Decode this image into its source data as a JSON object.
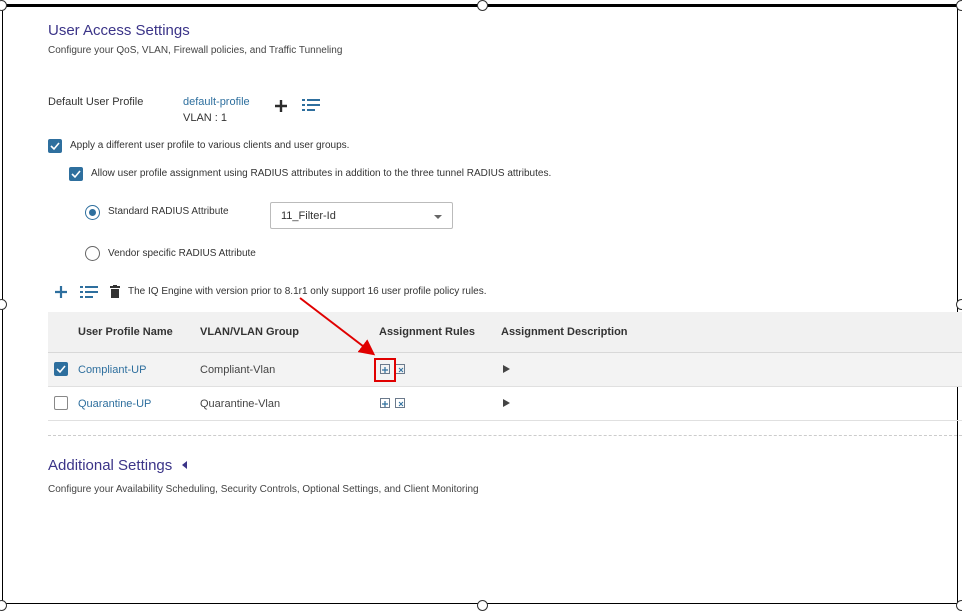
{
  "user_access": {
    "title": "User Access Settings",
    "subtitle": "Configure your QoS, VLAN, Firewall policies, and Traffic Tunneling",
    "default_profile_label": "Default User Profile",
    "default_profile_value": "default-profile",
    "default_profile_vlan": "VLAN : 1",
    "apply_diff_label": "Apply a different user profile to various clients and user groups.",
    "allow_radius_label": "Allow user profile assignment using RADIUS attributes in addition to the three tunnel RADIUS attributes.",
    "standard_radius_label": "Standard RADIUS Attribute",
    "standard_radius_select": "11_Filter-Id",
    "vendor_radius_label": "Vendor specific RADIUS Attribute",
    "note": "The IQ Engine with version prior to 8.1r1 only support 16 user profile policy rules."
  },
  "table": {
    "headers": [
      "User Profile Name",
      "VLAN/VLAN Group",
      "Assignment Rules",
      "Assignment Description"
    ],
    "rows": [
      {
        "name": "Compliant-UP",
        "vlan": "Compliant-Vlan",
        "checked": true
      },
      {
        "name": "Quarantine-UP",
        "vlan": "Quarantine-Vlan",
        "checked": false
      }
    ]
  },
  "additional": {
    "title": "Additional Settings",
    "subtitle": "Configure your Availability Scheduling, Security Controls, Optional Settings, and Client Monitoring"
  },
  "colors": {
    "accent": "#2e6f9e",
    "title": "#3b3488",
    "annotation": "#e00000"
  },
  "icons": [
    "plus-icon",
    "list-select-icon",
    "trash-icon",
    "add-rule-icon",
    "edit-rule-icon",
    "expand-icon",
    "collapse-icon"
  ]
}
